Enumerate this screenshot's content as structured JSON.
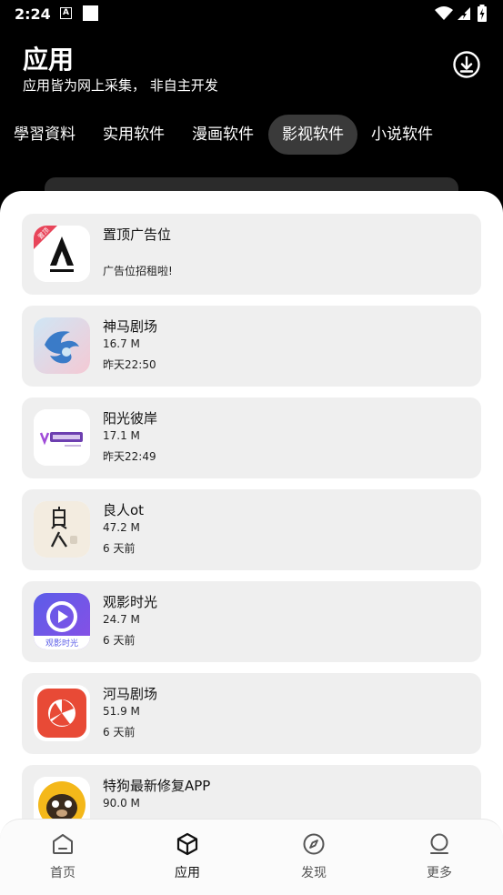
{
  "status": {
    "time": "2:24",
    "a_icon": "A"
  },
  "header": {
    "title": "应用",
    "subtitle": "应用皆为网上采集， 非自主开发"
  },
  "tabs": [
    {
      "label": "學習資料",
      "active": false
    },
    {
      "label": "实用软件",
      "active": false
    },
    {
      "label": "漫画软件",
      "active": false
    },
    {
      "label": "影视软件",
      "active": true
    },
    {
      "label": "小说软件",
      "active": false
    }
  ],
  "apps": [
    {
      "name": "置顶广告位",
      "size": "广告位招租啦!",
      "time": "",
      "icon": "ad-logo-icon",
      "badge": "置顶"
    },
    {
      "name": "神马剧场",
      "size": "16.7 M",
      "time": "昨天22:50",
      "icon": "shenma-app-icon"
    },
    {
      "name": "阳光彼岸",
      "size": "17.1 M",
      "time": "昨天22:49",
      "icon": "yangguang-app-icon"
    },
    {
      "name": "良人ot",
      "size": "47.2 M",
      "time": "6 天前",
      "icon": "liangren-app-icon"
    },
    {
      "name": "观影时光",
      "size": "24.7 M",
      "time": "6 天前",
      "icon": "guanying-app-icon",
      "icon_text": "观影时光"
    },
    {
      "name": "河马剧场",
      "size": "51.9 M",
      "time": "6 天前",
      "icon": "hema-app-icon"
    },
    {
      "name": "特狗最新修复APP",
      "size": "90.0 M",
      "time": "",
      "icon": "tegou-app-icon"
    }
  ],
  "bottom_nav": [
    {
      "label": "首页",
      "icon": "home-icon",
      "active": false
    },
    {
      "label": "应用",
      "icon": "box-icon",
      "active": true
    },
    {
      "label": "发现",
      "icon": "compass-icon",
      "active": false
    },
    {
      "label": "更多",
      "icon": "profile-icon",
      "active": false
    }
  ],
  "colors": {
    "background": "#000000",
    "card": "#efefef",
    "active_tab": "#3a3a3a",
    "badge": "#e8455a"
  }
}
